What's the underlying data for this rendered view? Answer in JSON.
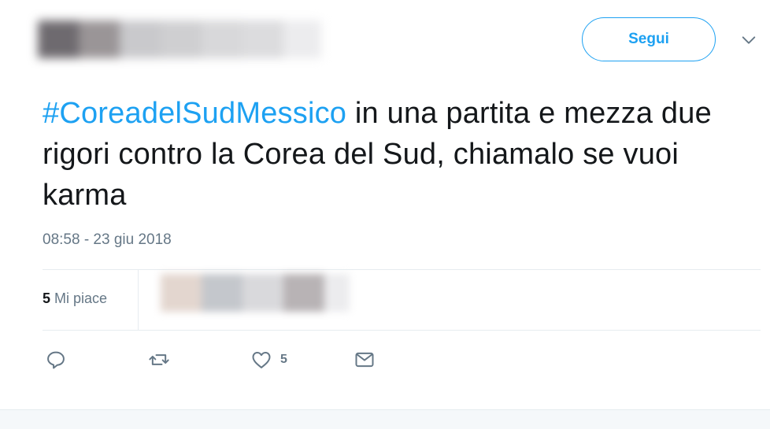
{
  "header": {
    "follow_label": "Segui"
  },
  "tweet": {
    "hashtag": "#CoreadelSudMessico",
    "body": " in una partita e mezza due rigori contro la Corea del Sud, chiamalo se vuoi karma",
    "timestamp": "08:58 - 23 giu 2018"
  },
  "stats": {
    "likes_number": "5",
    "likes_label": " Mi piace"
  },
  "actions": {
    "like_count": "5"
  },
  "icons": {
    "caret": "chevron-down-icon",
    "reply": "reply-icon",
    "retweet": "retweet-icon",
    "like": "heart-icon",
    "dm": "envelope-icon"
  },
  "colors": {
    "accent": "#1da1f2",
    "text": "#14171a",
    "secondary": "#657786",
    "border": "#e6ecf0"
  }
}
